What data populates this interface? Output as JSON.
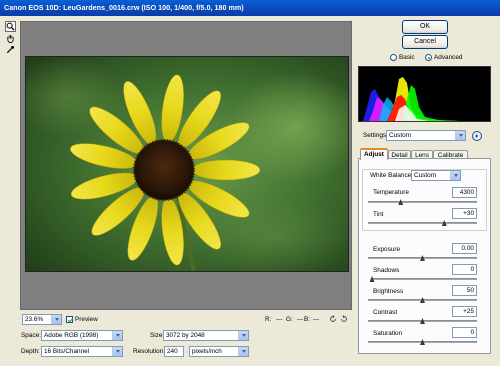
{
  "window": {
    "title": "Canon EOS 10D:  LeuGardens_0016.crw  (ISO 100, 1/400, f/5.0, 180 mm)"
  },
  "tools": [
    {
      "name": "zoom-tool-icon"
    },
    {
      "name": "hand-tool-icon"
    },
    {
      "name": "eyedropper-tool-icon"
    }
  ],
  "buttons": {
    "ok": "OK",
    "cancel": "Cancel"
  },
  "mode": {
    "basic": "Basic",
    "advanced": "Advanced",
    "selected": "Advanced"
  },
  "settings": {
    "label": "Settings:",
    "value": "Custom"
  },
  "tabs": [
    {
      "label": "Adjust",
      "active": true
    },
    {
      "label": "Detail",
      "active": false
    },
    {
      "label": "Lens",
      "active": false
    },
    {
      "label": "Calibrate",
      "active": false
    }
  ],
  "white_balance": {
    "label": "White Balance:",
    "value": "Custom",
    "temperature": {
      "label": "Temperature",
      "value": "4300",
      "slider_fraction": 0.3
    },
    "tint": {
      "label": "Tint",
      "value": "+30",
      "slider_fraction": 0.7
    }
  },
  "adjustments": [
    {
      "key": "exposure",
      "label": "Exposure",
      "value": "0.00",
      "slider_fraction": 0.5
    },
    {
      "key": "shadows",
      "label": "Shadows",
      "value": "0",
      "slider_fraction": 0.0
    },
    {
      "key": "brightness",
      "label": "Brightness",
      "value": "50",
      "slider_fraction": 0.5
    },
    {
      "key": "contrast",
      "label": "Contrast",
      "value": "+25",
      "slider_fraction": 0.5
    },
    {
      "key": "saturation",
      "label": "Saturation",
      "value": "0",
      "slider_fraction": 0.5
    }
  ],
  "preview_bar": {
    "zoom": "23.6%",
    "preview_label": "Preview",
    "preview_checked": true,
    "r_label": "R:",
    "r_value": "---",
    "g_label": "G:",
    "g_value": "---",
    "b_label": "B:",
    "b_value": "---"
  },
  "workflow": {
    "space_label": "Space:",
    "space_value": "Adobe RGB (1998)",
    "depth_label": "Depth:",
    "depth_value": "16 Bits/Channel",
    "size_label": "Size:",
    "size_value": "3072 by 2048",
    "resolution_label": "Resolution:",
    "resolution_value": "240",
    "resolution_unit": "pixels/inch"
  },
  "colors": {
    "titlebar": "#0b47b8",
    "preview_bg": "#7f7f7f",
    "active_tab_accent": "#e68b2c"
  }
}
